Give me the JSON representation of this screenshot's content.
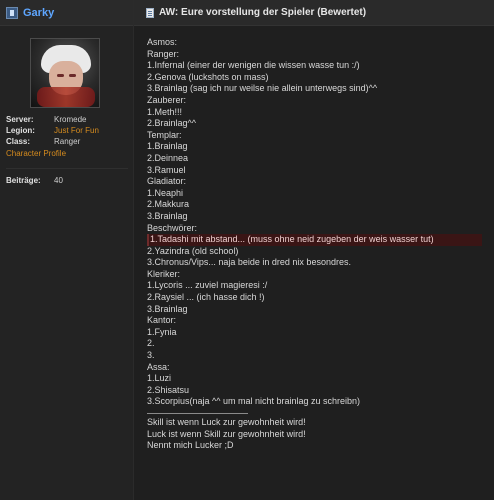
{
  "left": {
    "username": "Garky",
    "info": {
      "server_label": "Server:",
      "server_value": "Kromede",
      "legion_label": "Legion:",
      "legion_value": "Just For Fun",
      "class_label": "Class:",
      "class_value": "Ranger",
      "profile_link": "Character Profile",
      "posts_label": "Beiträge:",
      "posts_value": "40"
    }
  },
  "post": {
    "title": "AW: Eure vorstellung der Spieler (Bewertet)",
    "lines": [
      "Asmos:",
      "",
      "Ranger:",
      "1.Infernal (einer der wenigen die wissen wasse tun :/)",
      "2.Genova (luckshots on mass)",
      "3.Brainlag (sag ich nur weilse nie allein unterwegs sind)^^",
      "Zauberer:",
      "1.Meth!!!",
      "2.Brainlag^^",
      "Templar:",
      "1.Brainlag",
      "2.Deinnea",
      "3.Ramuel",
      "Gladiator:",
      "1.Neaphi",
      "2.Makkura",
      "3.Brainlag",
      "Beschwörer:",
      "1.Tadashi mit abstand... (muss ohne neid zugeben der weis wasser tut)",
      "2.Yazindra (old school)",
      "3.Chronus/Vips... naja beide in dred nix besondres.",
      "Kleriker:",
      "1.Lycoris ... zuviel magieresi :/",
      "2.Raysiel ... (ich hasse dich !)",
      "3.Brainlag",
      "Kantor:",
      "1.Fynia",
      "2.",
      "3.",
      "Assa:",
      "1.Luzi",
      "2.Shisatsu",
      "3.Scorpius(naja ^^ um mal nicht brainlag zu schreibn)"
    ],
    "signature": [
      "Skill ist wenn Luck zur gewohnheit wird!",
      "Luck ist wenn Skill zur gewohnheit wird!",
      "Nennt mich Lucker ;D"
    ]
  }
}
